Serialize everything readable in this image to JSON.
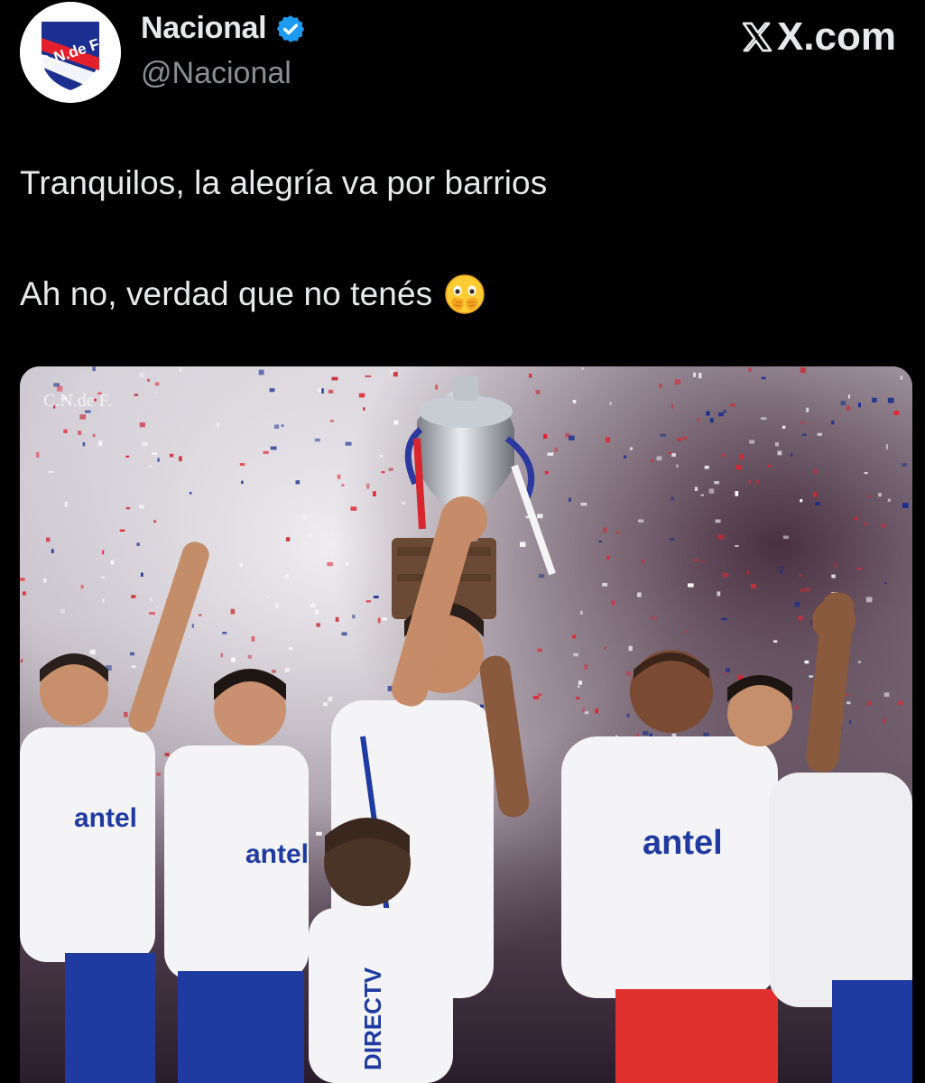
{
  "account": {
    "display_name": "Nacional",
    "handle": "@Nacional",
    "avatar_text": "C.N.de F.",
    "verified_icon": "verified-badge-icon"
  },
  "brand": {
    "site": "X.com",
    "logo_icon": "x-logo-icon"
  },
  "tweet": {
    "line1": "Tranquilos, la alegría va por barrios",
    "line2": "Ah no, verdad que no tenés",
    "emoji": "face-with-open-eyes-and-hand-over-mouth"
  },
  "media": {
    "watermark": "C.N.de F.",
    "shirt_sponsor": "antel",
    "side_sponsor": "DIRECTV",
    "description_icon": "trophy-celebration-photo"
  },
  "colors": {
    "background": "#000000",
    "text": "#e7e9ea",
    "secondary_text": "#8b8f94",
    "verified_blue": "#1d9bf0",
    "club_red": "#e4202c",
    "club_blue": "#1a2f8f"
  }
}
